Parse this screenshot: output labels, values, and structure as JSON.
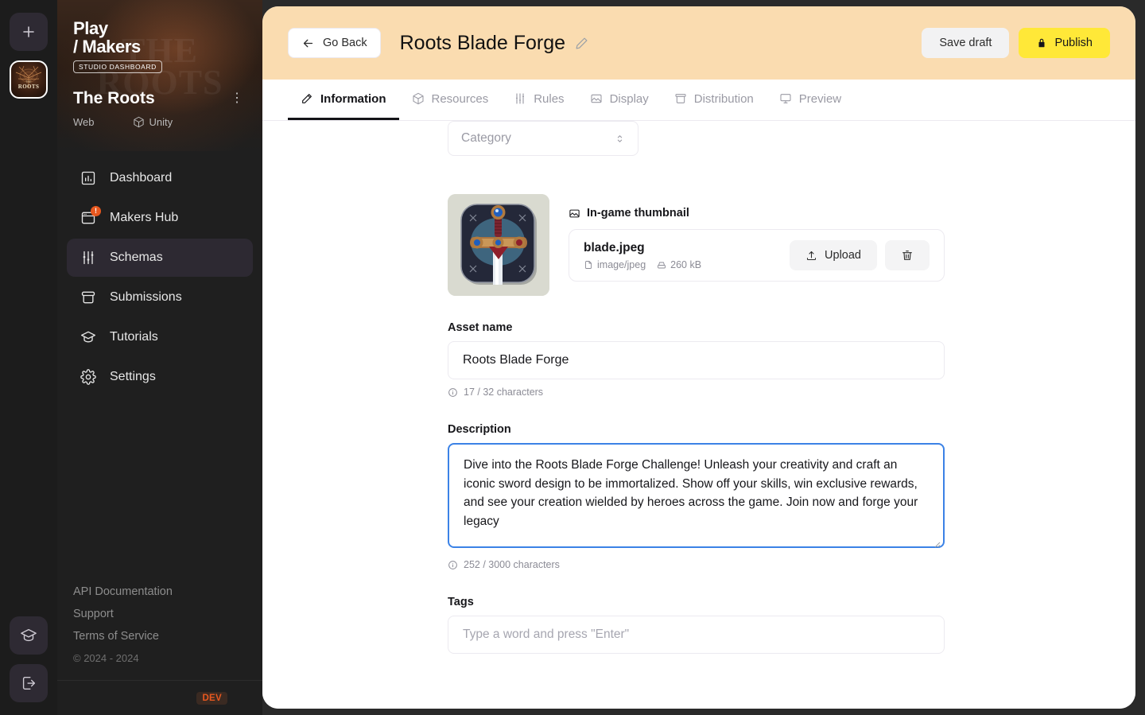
{
  "rail": {
    "add_label": "+",
    "workspace_mark": "ROOTS",
    "workspace_sub": "THE",
    "tutorials_icon": "graduation-cap-icon",
    "logout_icon": "logout-icon"
  },
  "sidebar": {
    "brand_line1": "Play",
    "brand_line2": "/ Makers",
    "studio_pill": "STUDIO DASHBOARD",
    "workspace_name": "The Roots",
    "workspace_menu": "⋮",
    "platform_web": "Web",
    "platform_unity": "Unity",
    "items": [
      {
        "label": "Dashboard",
        "icon": "bar-chart-icon",
        "active": false,
        "badge": ""
      },
      {
        "label": "Makers Hub",
        "icon": "browser-window-icon",
        "active": false,
        "badge": "!"
      },
      {
        "label": "Schemas",
        "icon": "sliders-icon",
        "active": true,
        "badge": ""
      },
      {
        "label": "Submissions",
        "icon": "archive-box-icon",
        "active": false,
        "badge": ""
      },
      {
        "label": "Tutorials",
        "icon": "graduation-cap-icon",
        "active": false,
        "badge": ""
      },
      {
        "label": "Settings",
        "icon": "gear-icon",
        "active": false,
        "badge": ""
      }
    ],
    "links": [
      "API Documentation",
      "Support",
      "Terms of Service"
    ],
    "copyright": "© 2024 - 2024",
    "env_badge": "DEV"
  },
  "header": {
    "go_back_label": "Go Back",
    "title": "Roots Blade Forge",
    "edit_icon": "pencil-icon",
    "save_draft_label": "Save draft",
    "publish_label": "Publish",
    "publish_icon": "lock-icon"
  },
  "tabs": [
    {
      "label": "Information",
      "icon": "pencil-square-icon",
      "active": true
    },
    {
      "label": "Resources",
      "icon": "box-icon",
      "active": false
    },
    {
      "label": "Rules",
      "icon": "sliders-icon",
      "active": false
    },
    {
      "label": "Display",
      "icon": "image-icon",
      "active": false
    },
    {
      "label": "Distribution",
      "icon": "archive-icon",
      "active": false
    },
    {
      "label": "Preview",
      "icon": "monitor-icon",
      "active": false
    }
  ],
  "form": {
    "category_placeholder": "Category",
    "category_icon": "chevron-updown-icon",
    "thumbnail_label": "In-game thumbnail",
    "thumbnail_icon": "image-icon",
    "file_name": "blade.jpeg",
    "file_type": "image/jpeg",
    "file_type_icon": "file-icon",
    "file_size": "260 kB",
    "file_size_icon": "hard-drive-icon",
    "upload_label": "Upload",
    "upload_icon": "upload-icon",
    "delete_icon": "trash-icon",
    "asset_name_label": "Asset name",
    "asset_name_value": "Roots Blade Forge",
    "asset_name_counter": "17 / 32 characters",
    "description_label": "Description",
    "description_value": "Dive into the Roots Blade Forge Challenge! Unleash your creativity and craft an iconic sword design to be immortalized. Show off your skills, win exclusive rewards, and see your creation wielded by heroes across the game. Join now and forge your legacy",
    "description_counter": "252 / 3000 characters",
    "tags_label": "Tags",
    "tags_placeholder": "Type a word and press \"Enter\"",
    "info_icon": "info-circle-icon"
  },
  "colors": {
    "header_banner": "#fadcb0",
    "publish_yellow": "#ffe838",
    "focus_blue": "#3b82e6",
    "badge_orange": "#e8581f",
    "dev_orange": "#e8581f"
  }
}
